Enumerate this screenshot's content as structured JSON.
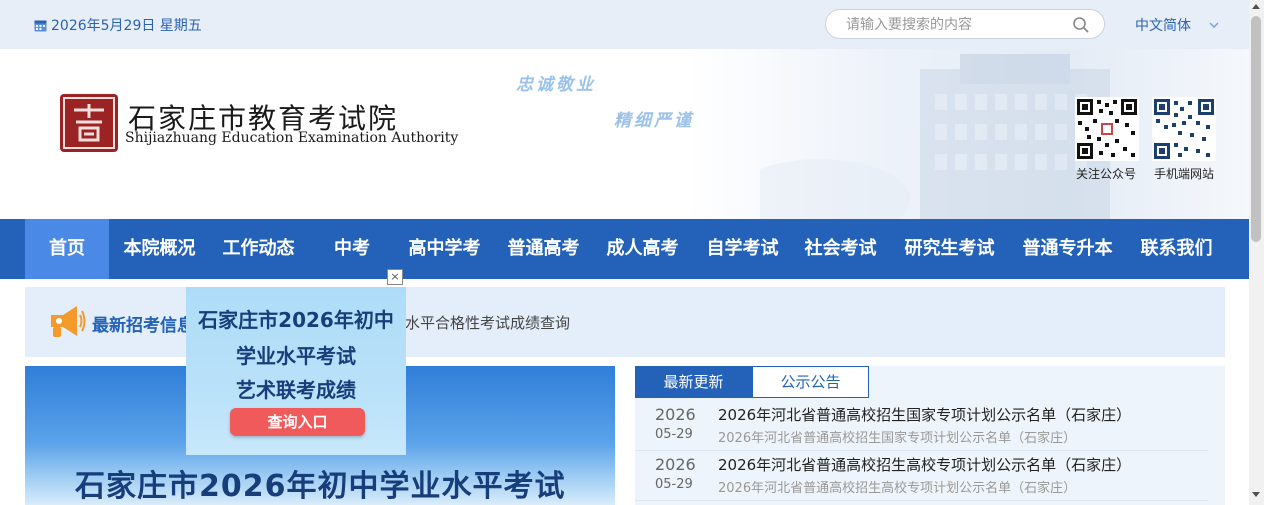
{
  "topbar": {
    "date": "2026年5月29日 星期五",
    "search_placeholder": "请输入要搜索的内容",
    "language": "中文简体"
  },
  "header": {
    "logo_cn": "石家庄市教育考试院",
    "logo_en": "Shijiazhuang Education Examination Authority",
    "slogan_1": "忠诚敬业",
    "slogan_2": "精细严谨",
    "qr_official_label": "关注公众号",
    "qr_mobile_label": "手机端网站"
  },
  "nav": {
    "items": [
      {
        "label": "首页"
      },
      {
        "label": "本院概况"
      },
      {
        "label": "工作动态"
      },
      {
        "label": "中考"
      },
      {
        "label": "高中学考"
      },
      {
        "label": "普通高考"
      },
      {
        "label": "成人高考"
      },
      {
        "label": "自学考试"
      },
      {
        "label": "社会考试"
      },
      {
        "label": "研究生考试"
      },
      {
        "label": "普通专升本"
      },
      {
        "label": "联系我们"
      }
    ]
  },
  "notice": {
    "title": "最新招考信息",
    "text": "水平合格性考试成绩查询"
  },
  "popup": {
    "line1": "石家庄市2026年初中",
    "line2": "学业水平考试",
    "line3": "艺术联考成绩",
    "button": "查询入口",
    "close": "×"
  },
  "carousel": {
    "title": "石家庄市2026年初中学业水平考试"
  },
  "news": {
    "tabs": [
      {
        "label": "最新更新"
      },
      {
        "label": "公示公告"
      }
    ],
    "items": [
      {
        "year": "2026",
        "md": "05-29",
        "title": "2026年河北省普通高校招生国家专项计划公示名单（石家庄）",
        "subtitle": "2026年河北省普通高校招生国家专项计划公示名单（石家庄）"
      },
      {
        "year": "2026",
        "md": "05-29",
        "title": "2026年河北省普通高校招生高校专项计划公示名单（石家庄）",
        "subtitle": "2026年河北省普通高校招生高校专项计划公示名单（石家庄）"
      }
    ]
  },
  "colors": {
    "nav_blue": "#2362b8",
    "nav_active": "#4a8ae6",
    "popup_button": "#f05a5a"
  }
}
